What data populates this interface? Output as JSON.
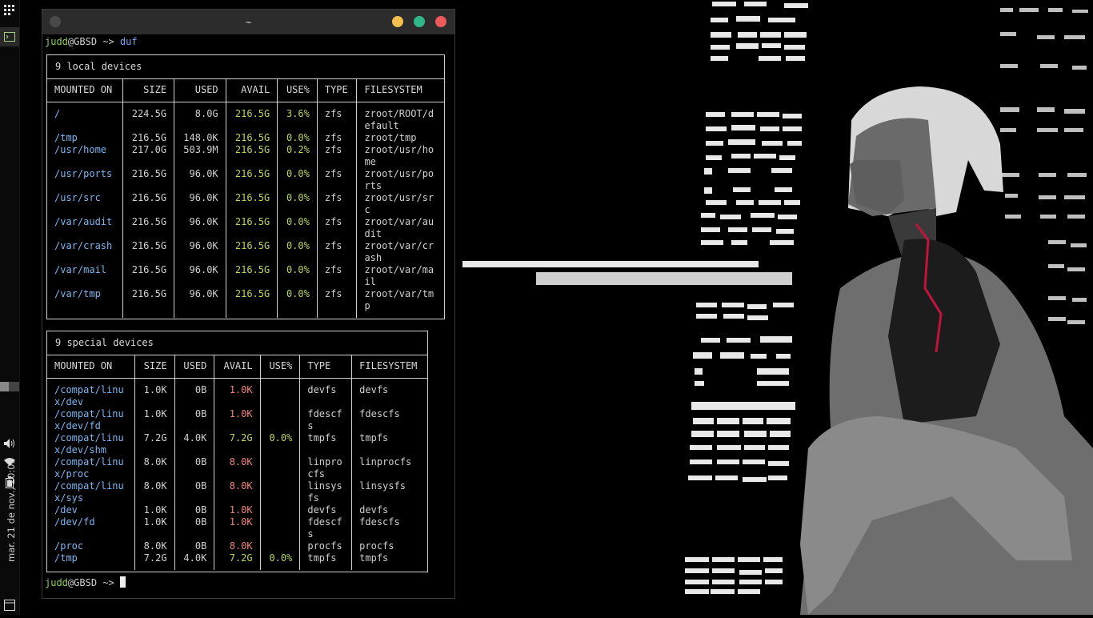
{
  "terminal": {
    "title": "~",
    "prompt": {
      "user": "judd",
      "at": "@",
      "host": "GBSD",
      "arrow": " ~> "
    },
    "command": "duf"
  },
  "local": {
    "header": "9 local devices",
    "columns": [
      "MOUNTED ON",
      "SIZE",
      "USED",
      "AVAIL",
      "USE%",
      "TYPE",
      "FILESYSTEM"
    ],
    "rows": [
      {
        "mount": "/",
        "size": "224.5G",
        "used": "8.0G",
        "avail": "216.5G",
        "use": "3.6%",
        "type": "zfs",
        "fs": "zroot/ROOT/d\nefault"
      },
      {
        "mount": "/tmp",
        "size": "216.5G",
        "used": "148.0K",
        "avail": "216.5G",
        "use": "0.0%",
        "type": "zfs",
        "fs": "zroot/tmp"
      },
      {
        "mount": "/usr/home",
        "size": "217.0G",
        "used": "503.9M",
        "avail": "216.5G",
        "use": "0.2%",
        "type": "zfs",
        "fs": "zroot/usr/ho\nme"
      },
      {
        "mount": "/usr/ports",
        "size": "216.5G",
        "used": "96.0K",
        "avail": "216.5G",
        "use": "0.0%",
        "type": "zfs",
        "fs": "zroot/usr/po\nrts"
      },
      {
        "mount": "/usr/src",
        "size": "216.5G",
        "used": "96.0K",
        "avail": "216.5G",
        "use": "0.0%",
        "type": "zfs",
        "fs": "zroot/usr/sr\nc"
      },
      {
        "mount": "/var/audit",
        "size": "216.5G",
        "used": "96.0K",
        "avail": "216.5G",
        "use": "0.0%",
        "type": "zfs",
        "fs": "zroot/var/au\ndit"
      },
      {
        "mount": "/var/crash",
        "size": "216.5G",
        "used": "96.0K",
        "avail": "216.5G",
        "use": "0.0%",
        "type": "zfs",
        "fs": "zroot/var/cr\nash"
      },
      {
        "mount": "/var/mail",
        "size": "216.5G",
        "used": "96.0K",
        "avail": "216.5G",
        "use": "0.0%",
        "type": "zfs",
        "fs": "zroot/var/ma\nil"
      },
      {
        "mount": "/var/tmp",
        "size": "216.5G",
        "used": "96.0K",
        "avail": "216.5G",
        "use": "0.0%",
        "type": "zfs",
        "fs": "zroot/var/tm\np"
      }
    ]
  },
  "special": {
    "header": "9 special devices",
    "columns": [
      "MOUNTED ON",
      "SIZE",
      "USED",
      "AVAIL",
      "USE%",
      "TYPE",
      "FILESYSTEM"
    ],
    "rows": [
      {
        "mount": "/compat/linu\nx/dev",
        "size": "1.0K",
        "used": "0B",
        "avail": "1.0K",
        "use": "",
        "type": "devfs",
        "fs": "devfs"
      },
      {
        "mount": "/compat/linu\nx/dev/fd",
        "size": "1.0K",
        "used": "0B",
        "avail": "1.0K",
        "use": "",
        "type": "fdescf\ns",
        "fs": "fdescfs"
      },
      {
        "mount": "/compat/linu\nx/dev/shm",
        "size": "7.2G",
        "used": "4.0K",
        "avail": "7.2G",
        "use": "0.0%",
        "type": "tmpfs",
        "fs": "tmpfs"
      },
      {
        "mount": "/compat/linu\nx/proc",
        "size": "8.0K",
        "used": "0B",
        "avail": "8.0K",
        "use": "",
        "type": "linpro\ncfs",
        "fs": "linprocfs"
      },
      {
        "mount": "/compat/linu\nx/sys",
        "size": "8.0K",
        "used": "0B",
        "avail": "8.0K",
        "use": "",
        "type": "linsys\nfs",
        "fs": "linsysfs"
      },
      {
        "mount": "/dev",
        "size": "1.0K",
        "used": "0B",
        "avail": "1.0K",
        "use": "",
        "type": "devfs",
        "fs": "devfs"
      },
      {
        "mount": "/dev/fd",
        "size": "1.0K",
        "used": "0B",
        "avail": "1.0K",
        "use": "",
        "type": "fdescf\ns",
        "fs": "fdescfs"
      },
      {
        "mount": "/proc",
        "size": "8.0K",
        "used": "0B",
        "avail": "8.0K",
        "use": "",
        "type": "procfs",
        "fs": "procfs"
      },
      {
        "mount": "/tmp",
        "size": "7.2G",
        "used": "4.0K",
        "avail": "7.2G",
        "use": "0.0%",
        "type": "tmpfs",
        "fs": "tmpfs"
      }
    ]
  },
  "dock": {
    "datetime": "mar. 21 de nov., 20:03",
    "icons": [
      "apps-grid-icon",
      "terminal-icon",
      "workspace-indicator-icon",
      "volume-icon",
      "wifi-icon",
      "battery-icon",
      "desktop-icon"
    ]
  },
  "colors": {
    "titlebar": "#2c2c2c",
    "btn_minimize": "#f4bf4f",
    "btn_maximize": "#2eb889",
    "btn_close": "#ec5a5a",
    "prompt_user": "#8fd14f",
    "mount": "#7cb6f2",
    "avail_ok": "#b8d85a",
    "avail_warn": "#f2837a"
  }
}
